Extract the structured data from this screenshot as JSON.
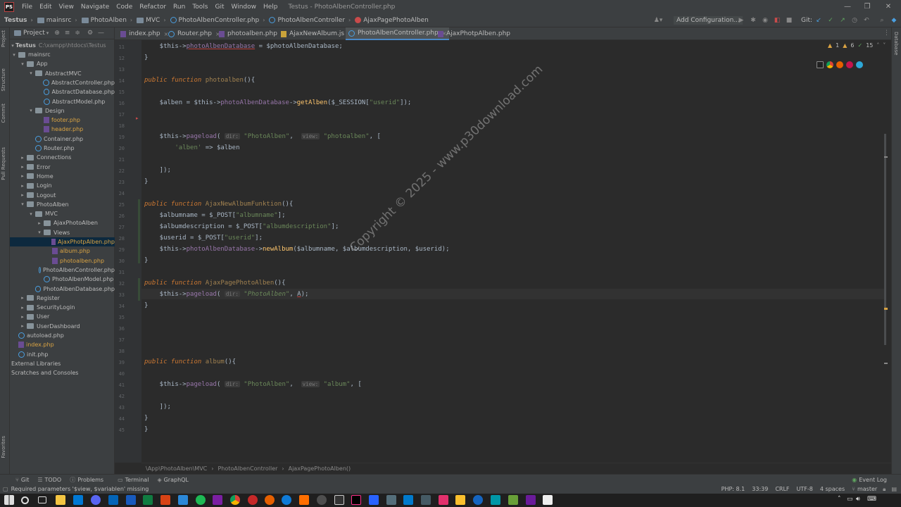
{
  "menubar": {
    "logo": "PS",
    "items": [
      "File",
      "Edit",
      "View",
      "Navigate",
      "Code",
      "Refactor",
      "Run",
      "Tools",
      "Git",
      "Window",
      "Help"
    ],
    "window_title": "Testus - PhotoAlbenController.php"
  },
  "navbar": {
    "crumbs": [
      "Testus",
      "mainsrc",
      "PhotoAlben",
      "MVC",
      "PhotoAlbenController.php",
      "PhotoAlbenController",
      "AjaxPagePhotoAlben"
    ],
    "add_config": "Add Configuration...",
    "git_label": "Git:"
  },
  "project": {
    "title": "Project",
    "root_name": "Testus",
    "root_path": "C:\\xampp\\htdocs\\Testus",
    "tree": [
      {
        "label": "mainsrc",
        "type": "folder",
        "arrow": "▾"
      },
      {
        "label": "App",
        "type": "folder",
        "arrow": "▾"
      },
      {
        "label": "AbstractMVC",
        "type": "folder",
        "arrow": "▾"
      },
      {
        "label": "AbstractController.php",
        "type": "class"
      },
      {
        "label": "AbstractDatabase.php",
        "type": "class"
      },
      {
        "label": "AbstractModel.php",
        "type": "class"
      },
      {
        "label": "Design",
        "type": "folder",
        "arrow": "▾"
      },
      {
        "label": "footer.php",
        "type": "php"
      },
      {
        "label": "header.php",
        "type": "php"
      },
      {
        "label": "Container.php",
        "type": "class"
      },
      {
        "label": "Router.php",
        "type": "class"
      },
      {
        "label": "Connections",
        "type": "folder",
        "arrow": "▸"
      },
      {
        "label": "Error",
        "type": "folder",
        "arrow": "▸"
      },
      {
        "label": "Home",
        "type": "folder",
        "arrow": "▸"
      },
      {
        "label": "Login",
        "type": "folder",
        "arrow": "▸"
      },
      {
        "label": "Logout",
        "type": "folder",
        "arrow": "▸"
      },
      {
        "label": "PhotoAlben",
        "type": "folder",
        "arrow": "▾"
      },
      {
        "label": "MVC",
        "type": "folder",
        "arrow": "▾"
      },
      {
        "label": "AjaxPhotoAlben",
        "type": "folder",
        "arrow": "▸"
      },
      {
        "label": "Views",
        "type": "folder",
        "arrow": "▾"
      },
      {
        "label": "AjaxPhotpAlben.php",
        "type": "php"
      },
      {
        "label": "album.php",
        "type": "php"
      },
      {
        "label": "photoalben.php",
        "type": "php"
      },
      {
        "label": "PhotoAlbenController.php",
        "type": "class"
      },
      {
        "label": "PhotoAlbenModel.php",
        "type": "class"
      },
      {
        "label": "PhotoAlbenDatabase.php",
        "type": "class"
      },
      {
        "label": "Register",
        "type": "folder",
        "arrow": "▸"
      },
      {
        "label": "SecurityLogin",
        "type": "folder",
        "arrow": "▸"
      },
      {
        "label": "User",
        "type": "folder",
        "arrow": "▸"
      },
      {
        "label": "UserDashboard",
        "type": "folder",
        "arrow": "▸"
      },
      {
        "label": "autoload.php",
        "type": "class"
      },
      {
        "label": "index.php",
        "type": "php"
      },
      {
        "label": "init.php",
        "type": "class"
      },
      {
        "label": "External Libraries",
        "type": "lib"
      },
      {
        "label": "Scratches and Consoles",
        "type": "lib"
      }
    ]
  },
  "tabs": [
    {
      "label": "index.php",
      "icon": "php"
    },
    {
      "label": "Router.php",
      "icon": "class"
    },
    {
      "label": "photoalben.php",
      "icon": "php"
    },
    {
      "label": "AjaxNewAlbum.js",
      "icon": "js"
    },
    {
      "label": "PhotoAlbenController.php",
      "icon": "class",
      "active": true
    },
    {
      "label": "AjaxPhotpAlben.php",
      "icon": "php"
    }
  ],
  "editor": {
    "line_numbers": [
      "11",
      "12",
      "13",
      "14",
      "15",
      "16",
      "17",
      "18",
      "19",
      "20",
      "21",
      "22",
      "23",
      "24",
      "25",
      "26",
      "27",
      "28",
      "29",
      "30",
      "31",
      "32",
      "33",
      "34",
      "35",
      "36",
      "37",
      "38",
      "39",
      "40",
      "41",
      "42",
      "43",
      "44",
      "45"
    ],
    "inspections": {
      "warnings": "1",
      "weak": "6",
      "typos": "15"
    },
    "watermark": "Copyright © 2025 - www.p30download.com"
  },
  "code_breadcrumb": [
    "\\App\\PhotoAlben\\MVC",
    "PhotoAlbenController",
    "AjaxPagePhotoAlben()"
  ],
  "toolwindows": [
    "Git",
    "TODO",
    "Problems",
    "Terminal",
    "GraphQL"
  ],
  "event_log": "Event Log",
  "status": {
    "message": "Required parameters '$view, $variablen' missing",
    "php": "PHP: 8.1",
    "position": "33:39",
    "line_sep": "CRLF",
    "encoding": "UTF-8",
    "indent": "4 spaces",
    "branch": "master"
  },
  "colors": {
    "accent": "#4a88c7",
    "keyword": "#cc7832",
    "string": "#6a8759",
    "function": "#ffc66d",
    "field": "#9876aa"
  }
}
